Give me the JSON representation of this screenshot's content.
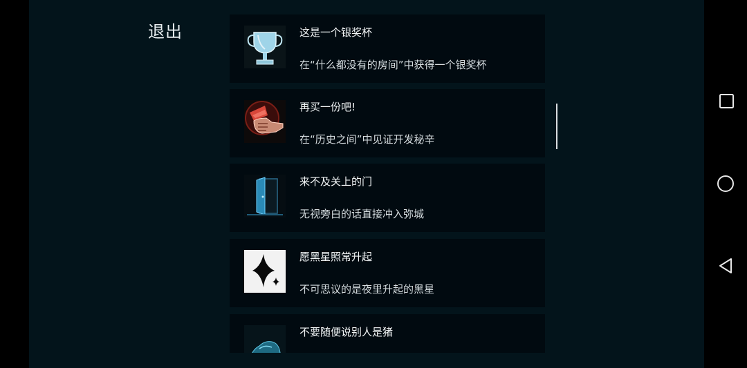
{
  "header": {
    "exit_label": "退出"
  },
  "achievements": [
    {
      "title": "这是一个银奖杯",
      "description": "在“什么都没有的房间”中获得一个银奖杯",
      "icon": "silver-trophy-icon"
    },
    {
      "title": "再买一份吧!",
      "description": "在“历史之间”中见证开发秘辛",
      "icon": "fist-holding-money-icon"
    },
    {
      "title": "来不及关上的门",
      "description": "无视旁白的话直接冲入弥城",
      "icon": "open-door-icon"
    },
    {
      "title": "愿黑星照常升起",
      "description": "不可思议的是夜里升起的黑星",
      "icon": "black-star-icon"
    },
    {
      "title": "不要随便说别人是猪",
      "description": "",
      "icon": "blue-creature-icon"
    }
  ],
  "navbar": {
    "buttons": [
      "recent-apps",
      "home",
      "back"
    ]
  }
}
